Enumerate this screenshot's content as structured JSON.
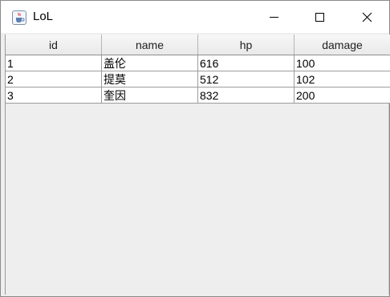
{
  "window": {
    "title": "LoL"
  },
  "table": {
    "columns": [
      "id",
      "name",
      "hp",
      "damage"
    ],
    "rows": [
      [
        "1",
        "盖伦",
        "616",
        "100"
      ],
      [
        "2",
        "提莫",
        "512",
        "102"
      ],
      [
        "3",
        "奎因",
        "832",
        "200"
      ]
    ]
  },
  "icons": {
    "app": "java-cup-icon",
    "minimize": "minimize-icon",
    "maximize": "maximize-icon",
    "close": "close-icon"
  }
}
